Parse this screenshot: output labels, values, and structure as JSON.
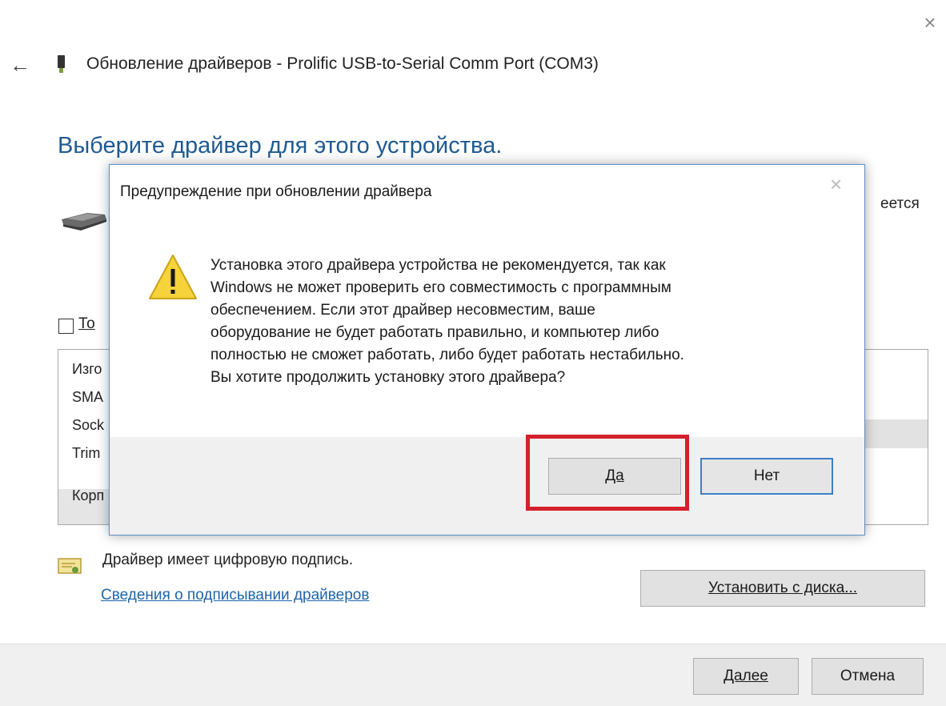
{
  "window": {
    "title": "Обновление драйверов - Prolific USB-to-Serial Comm Port (COM3)",
    "close_glyph": "×",
    "back_glyph": "←"
  },
  "main": {
    "heading": "Выберите драйвер для этого устройства.",
    "partial_instruction": "еется",
    "checkbox_label_partial": "То",
    "manufacturers": [
      "Изго",
      "SMA",
      "Sock",
      "Trim",
      "Корп"
    ]
  },
  "signature": {
    "text": "Драйвер имеет цифровую подпись.",
    "link": "Сведения о подписывании драйверов"
  },
  "buttons": {
    "install_from_disk": "Установить с диска...",
    "next": "Далее",
    "cancel": "Отмена"
  },
  "dialog": {
    "title": "Предупреждение при обновлении драйвера",
    "close_glyph": "×",
    "message_lines": [
      "Установка этого драйвера устройства не рекомендуется, так как",
      "Windows не может проверить его совместимость с программным",
      "обеспечением.  Если этот драйвер несовместим, ваше",
      "оборудование не будет работать правильно, и компьютер либо",
      "полностью не сможет работать, либо будет работать нестабильно.",
      "Вы хотите продолжить установку этого драйвера?"
    ],
    "yes_label": "Да",
    "no_label": "Нет",
    "highlight_color": "#d4202a"
  },
  "colors": {
    "heading": "#1f5a92",
    "link": "#1f64a8",
    "dialog_border": "#5a8fc8",
    "warning": "#f6d23b"
  }
}
